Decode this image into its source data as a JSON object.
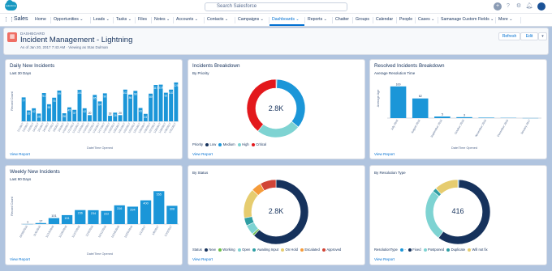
{
  "topbar": {
    "logo_text": "salesforce",
    "search_placeholder": "Search Salesforce",
    "icons": [
      "add-icon",
      "help-icon",
      "setup-gear-icon",
      "notifications-bell-icon",
      "user-avatar"
    ]
  },
  "nav": {
    "app_name": "Sales",
    "items": [
      "Home",
      "Opportunities",
      "Leads",
      "Tasks",
      "Files",
      "Notes",
      "Accounts",
      "Contacts",
      "Campaigns",
      "Dashboards",
      "Reports",
      "Chatter",
      "Groups",
      "Calendar",
      "People",
      "Cases",
      "Samanage Custom Fields",
      "More"
    ],
    "active": "Dashboards"
  },
  "header": {
    "eyebrow": "DASHBOARD",
    "title": "Incident Management - Lightning",
    "as_of": "As of Jan 20, 2017 7:43 AM · Viewing as Stas Dulman",
    "refresh_label": "Refresh",
    "edit_label": "Edit"
  },
  "view_report_label": "View Report",
  "cards": {
    "daily": {
      "title": "Daily New Incidents",
      "subtitle": "Last 30 Days"
    },
    "breakdown": {
      "title": "Incidents Breakdown",
      "subtitle": "By Priority",
      "center": "2.8K"
    },
    "resolved": {
      "title": "Resolved Incidents Breakdown",
      "subtitle": "Average Resolution Time"
    },
    "weekly": {
      "title": "Weekly New Incidents",
      "subtitle": "Last 90 Days"
    },
    "status": {
      "subtitle": "By Status",
      "center": "2.8K"
    },
    "resolution": {
      "subtitle": "By Resolution Type",
      "center": "416"
    }
  },
  "chart_data": [
    {
      "id": "daily",
      "type": "bar",
      "xlabel": "Date/Time Opened",
      "ylabel": "Record Count",
      "color": "#1b96d8",
      "ylim": [
        0,
        130
      ],
      "categories": [
        "1/1/2017",
        "1/2/2017",
        "1/3/2017",
        "1/4/2017",
        "1/5/2017",
        "1/6/2017",
        "1/7/2017",
        "1/8/2017",
        "1/9/2017",
        "1/10/2017",
        "1/11/2017",
        "1/12/2017",
        "1/13/2017",
        "1/14/2017",
        "1/15/2017",
        "1/16/2017",
        "1/17/2017",
        "1/18/2017",
        "1/19/2017",
        "1/20/2017",
        "1/21/2017",
        "1/22/2017",
        "1/23/2017",
        "1/24/2017",
        "1/25/2017",
        "1/26/2017",
        "1/27/2017",
        "1/28/2017",
        "1/29/2017",
        "1/30/2017",
        "1/31/2017"
      ],
      "values": [
        77,
        35,
        42,
        25,
        91,
        55,
        76,
        99,
        26,
        45,
        37,
        101,
        42,
        20,
        85,
        64,
        90,
        18,
        28,
        20,
        102,
        86,
        98,
        43,
        24,
        89,
        117,
        118,
        92,
        102,
        125
      ],
      "value_labels": [
        "77",
        "35",
        "42",
        "25",
        "91",
        "55",
        "76",
        "99",
        "26",
        "45",
        "37",
        "101",
        "42",
        "20",
        "85",
        "64",
        "90",
        "18",
        "28",
        "20",
        "102",
        "86",
        "98",
        "43",
        "24",
        "89",
        "117",
        "118",
        "92",
        "102",
        "125"
      ]
    },
    {
      "id": "breakdown",
      "type": "pie",
      "legend_title": "Priority",
      "labels": [
        "Low",
        "Medium",
        "High",
        "Critical"
      ],
      "values": [
        0.4,
        29,
        20,
        32
      ],
      "colors": [
        "#16325c",
        "#1b96d8",
        "#7ed3d2",
        "#e3181c"
      ]
    },
    {
      "id": "resolved",
      "type": "bar",
      "xlabel": "Date/Time Opened",
      "ylabel": "Average Age",
      "color": "#1b96d8",
      "categories": [
        "July 2016",
        "August 2016",
        "September 2016",
        "October 2016",
        "November 2016",
        "December 2016",
        "January 2017"
      ],
      "values": [
        100,
        62,
        5,
        3,
        1.5,
        0.8,
        0.3
      ],
      "value_labels": [
        "100",
        "62",
        "5",
        "3",
        "",
        "",
        ""
      ]
    },
    {
      "id": "weekly",
      "type": "bar",
      "xlabel": "Date/Time Opened",
      "ylabel": "Record Count",
      "color": "#1b96d8",
      "ylim": [
        0,
        600
      ],
      "categories": [
        "10/30/2016",
        "11/6/2016",
        "11/13/2016",
        "11/20/2016",
        "11/27/2016",
        "12/4/2016",
        "12/11/2016",
        "12/18/2016",
        "12/25/2016",
        "1/1/2017",
        "1/8/2017",
        "1/15/2017"
      ],
      "values": [
        1,
        17,
        101,
        151,
        236,
        234,
        222,
        316,
        294,
        400,
        555,
        308
      ],
      "value_labels": [
        "1",
        "17",
        "101",
        "151",
        "236",
        "234",
        "222",
        "316",
        "294",
        "400",
        "555",
        "308"
      ]
    },
    {
      "id": "status",
      "type": "pie",
      "legend_title": "Status",
      "labels": [
        "New",
        "Working",
        "Open",
        "Awaiting Input",
        "On Hold",
        "Escalated",
        "Approved"
      ],
      "values": [
        62,
        1,
        5,
        4,
        15,
        5,
        8
      ],
      "colors": [
        "#16325c",
        "#6bbf4a",
        "#7ed3d2",
        "#2f9ea3",
        "#e6cc6f",
        "#f59b3a",
        "#d14436"
      ]
    },
    {
      "id": "resolution",
      "type": "pie",
      "legend_title": "ResolutionType",
      "labels": [
        "-",
        "Fixed",
        "Postponed",
        "Duplicate",
        "Will not fix"
      ],
      "values": [
        0.5,
        60,
        26,
        2,
        12
      ],
      "colors": [
        "#1b96d8",
        "#16325c",
        "#7ed3d2",
        "#2f9ea3",
        "#e6cc6f"
      ]
    }
  ]
}
